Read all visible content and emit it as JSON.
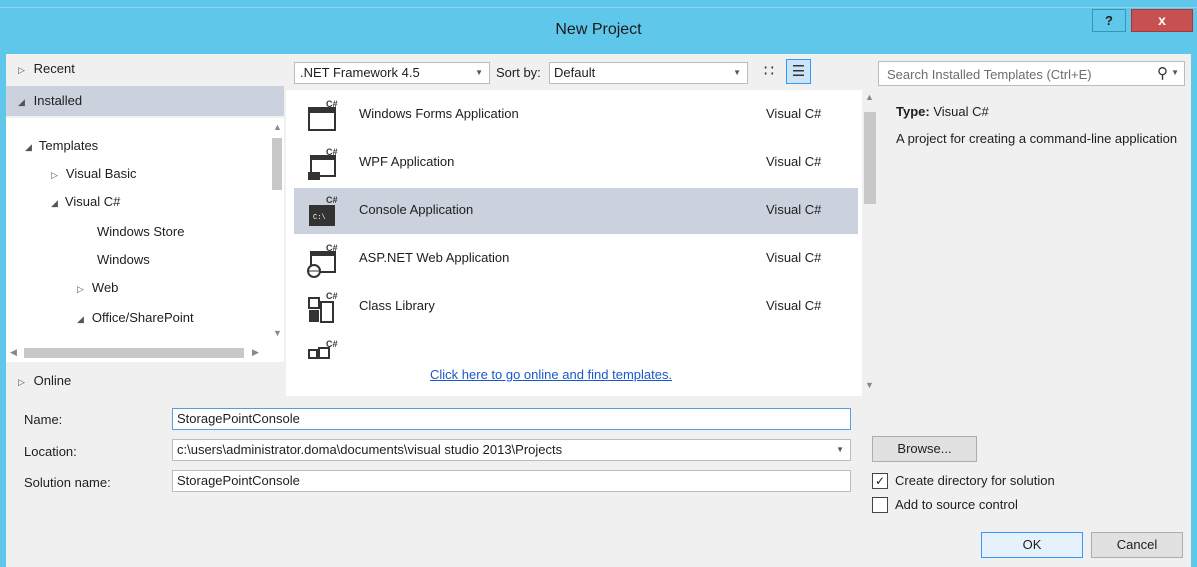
{
  "window": {
    "title": "New Project",
    "help_label": "?",
    "close_label": "x"
  },
  "nav": {
    "recent": "Recent",
    "installed": "Installed",
    "online": "Online",
    "tree": {
      "templates": "Templates",
      "visual_basic": "Visual Basic",
      "visual_csharp": "Visual C#",
      "windows_store": "Windows Store",
      "windows": "Windows",
      "web": "Web",
      "office_sharepoint": "Office/SharePoint"
    }
  },
  "toolbar": {
    "framework": ".NET Framework 4.5",
    "sort_by_label": "Sort by:",
    "sort_by_value": "Default"
  },
  "search": {
    "placeholder": "Search Installed Templates (Ctrl+E)"
  },
  "templates": [
    {
      "name": "Windows Forms Application",
      "lang": "Visual C#"
    },
    {
      "name": "WPF Application",
      "lang": "Visual C#"
    },
    {
      "name": "Console Application",
      "lang": "Visual C#",
      "selected": true
    },
    {
      "name": "ASP.NET Web Application",
      "lang": "Visual C#"
    },
    {
      "name": "Class Library",
      "lang": "Visual C#"
    }
  ],
  "online_link": "Click here to go online and find templates.",
  "details": {
    "type_label": "Type:",
    "type_value": "Visual C#",
    "description": "A project for creating a command-line application"
  },
  "form": {
    "name_label": "Name:",
    "name_value": "StoragePointConsole",
    "location_label": "Location:",
    "location_value": "c:\\users\\administrator.doma\\documents\\visual studio 2013\\Projects",
    "solution_label": "Solution name:",
    "solution_value": "StoragePointConsole",
    "browse_label": "Browse...",
    "create_dir_label": "Create directory for solution",
    "create_dir_checked": true,
    "source_control_label": "Add to source control",
    "source_control_checked": false,
    "ok_label": "OK",
    "cancel_label": "Cancel"
  },
  "colors": {
    "titlebar": "#5fc8ea",
    "selection": "#cbd1dd",
    "close_button": "#c75050",
    "link": "#1a59c8"
  }
}
